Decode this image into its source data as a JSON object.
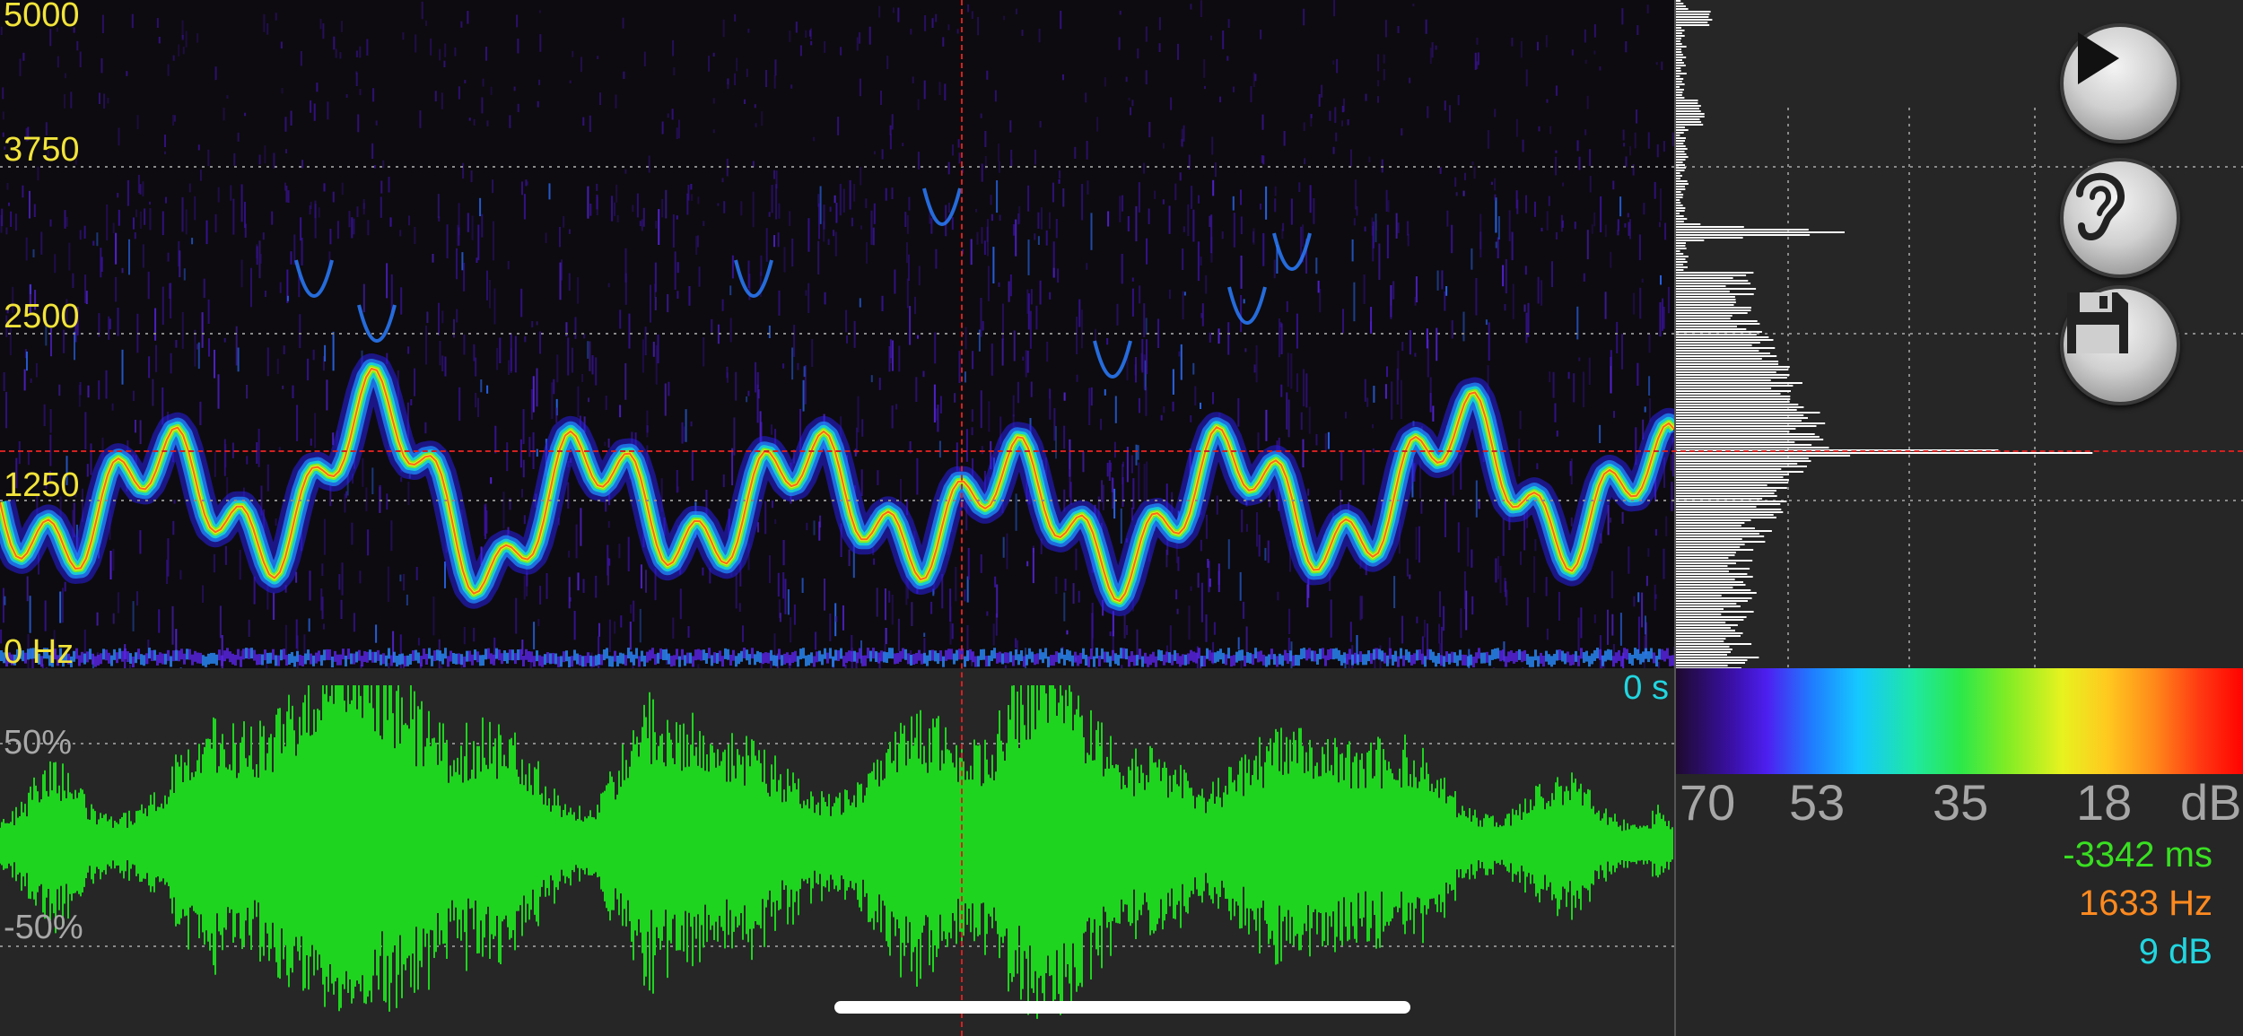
{
  "spectrogram": {
    "freq_labels": [
      "5000",
      "3750",
      "2500",
      "1250",
      "0 Hz"
    ],
    "colormap": [
      "#1e0a2e",
      "#3a10a8",
      "#4d1ff0",
      "#1f7dff",
      "#15c8ff",
      "#2be84a",
      "#e8f21f",
      "#ff8a1a",
      "#ff0000"
    ]
  },
  "waveform": {
    "amp_labels": [
      "50%",
      "-50%"
    ],
    "time_label": "0 s",
    "color": "#1fd41f"
  },
  "controls": {
    "play": "play-icon",
    "listen": "ear-icon",
    "save": "floppy-disk-icon"
  },
  "legend": {
    "db_ticks": [
      "70",
      "53",
      "35",
      "18",
      "dB"
    ]
  },
  "readout": {
    "time": "-3342 ms",
    "frequency": "1633 Hz",
    "level": "9 dB"
  },
  "colors": {
    "freq_label": "#f2e43a",
    "time_readout": "#39e021",
    "freq_readout": "#ff8a1f",
    "level_readout": "#21d6e0",
    "cursor": "#d42020"
  }
}
